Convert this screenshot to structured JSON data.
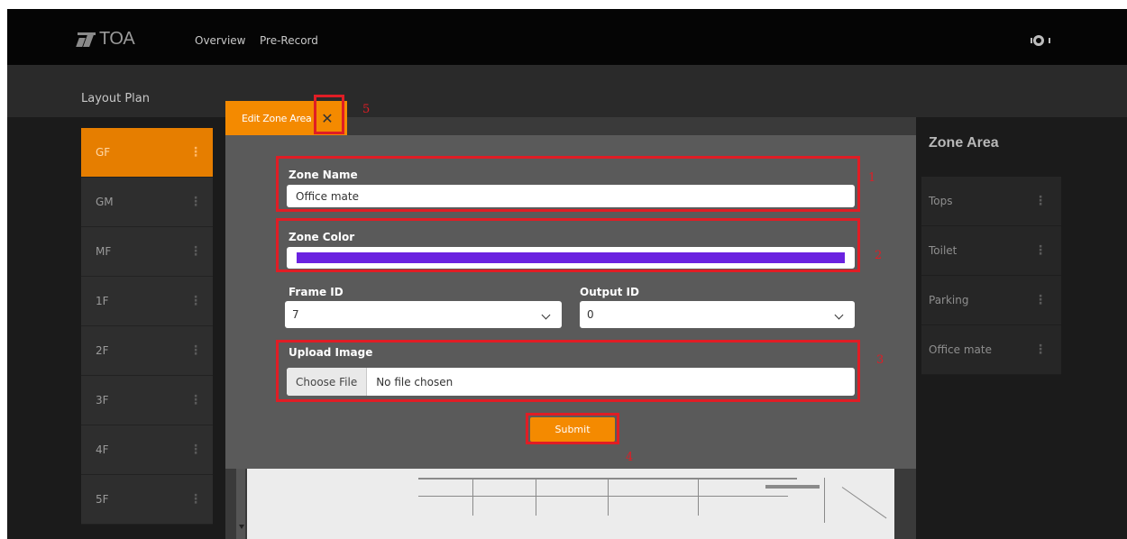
{
  "header": {
    "logo_text": "TOA",
    "nav": [
      "Overview",
      "Pre-Record"
    ]
  },
  "subheader": {
    "title": "Layout Plan"
  },
  "floors": [
    "GF",
    "GM",
    "MF",
    "1F",
    "2F",
    "3F",
    "4F",
    "5F"
  ],
  "active_floor": "GF",
  "zone_panel": {
    "title": "Zone Area",
    "items": [
      "Tops",
      "Toilet",
      "Parking",
      "Office mate"
    ]
  },
  "modal": {
    "tab_title": "Edit Zone Area",
    "zone_name_label": "Zone Name",
    "zone_name_value": "Office mate",
    "zone_color_label": "Zone Color",
    "zone_color_value": "#6a22e0",
    "frame_id_label": "Frame ID",
    "frame_id_value": "7",
    "output_id_label": "Output ID",
    "output_id_value": "0",
    "upload_label": "Upload Image",
    "choose_file_label": "Choose File",
    "file_status": "No file chosen",
    "submit_label": "Submit"
  },
  "annotations": [
    "1",
    "2",
    "3",
    "4",
    "5"
  ],
  "colors": {
    "accent": "#f48a00",
    "annotation": "#e01d25"
  }
}
